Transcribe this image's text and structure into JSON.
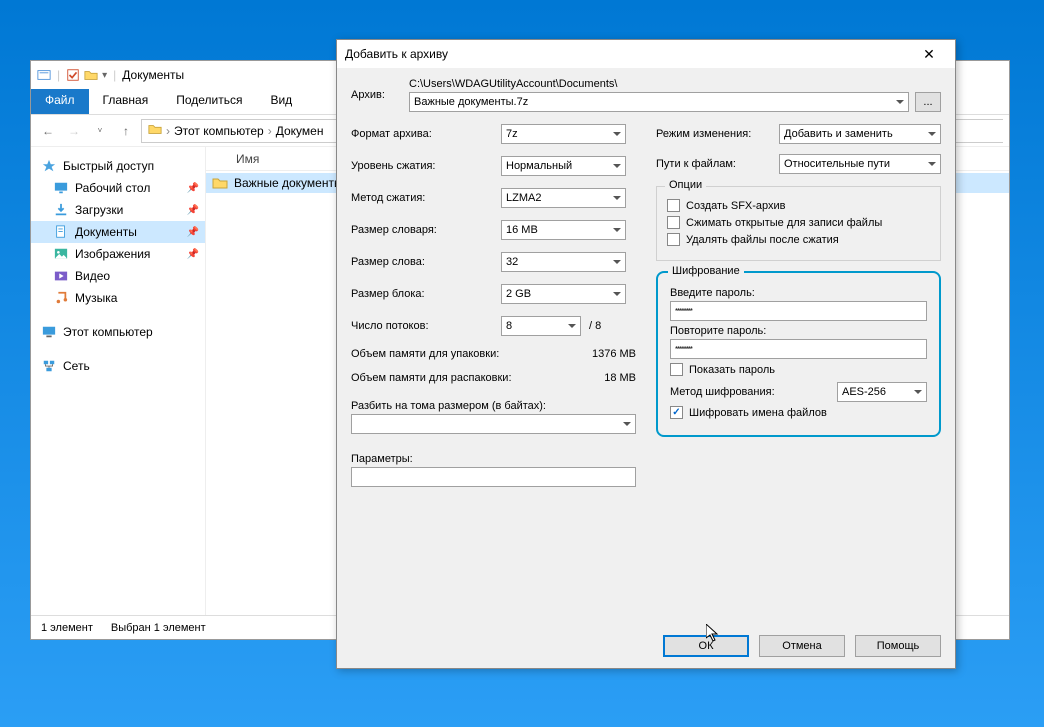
{
  "explorer": {
    "title": "Документы",
    "ribbon": {
      "tabs": [
        "Файл",
        "Главная",
        "Поделиться",
        "Вид"
      ]
    },
    "breadcrumb": {
      "root": "Этот компьютер",
      "current": "Докумен"
    },
    "sidebar": {
      "quick": "Быстрый доступ",
      "items": [
        {
          "label": "Рабочий стол",
          "pinned": true
        },
        {
          "label": "Загрузки",
          "pinned": true
        },
        {
          "label": "Документы",
          "pinned": true,
          "selected": true
        },
        {
          "label": "Изображения",
          "pinned": true
        },
        {
          "label": "Видео"
        },
        {
          "label": "Музыка"
        }
      ],
      "thispc": "Этот компьютер",
      "network": "Сеть"
    },
    "content": {
      "header_name": "Имя",
      "file": "Важные документы"
    },
    "status": {
      "count": "1 элемент",
      "selected": "Выбран 1 элемент"
    }
  },
  "dialog": {
    "title": "Добавить к архиву",
    "archive_label": "Архив:",
    "path": "C:\\Users\\WDAGUtilityAccount\\Documents\\",
    "name": "Важные документы.7z",
    "browse": "...",
    "left": {
      "format": {
        "label": "Формат архива:",
        "value": "7z"
      },
      "level": {
        "label": "Уровень сжатия:",
        "value": "Нормальный"
      },
      "method": {
        "label": "Метод сжатия:",
        "value": "LZMA2"
      },
      "dict": {
        "label": "Размер словаря:",
        "value": "16 MB"
      },
      "word": {
        "label": "Размер слова:",
        "value": "32"
      },
      "block": {
        "label": "Размер блока:",
        "value": "2 GB"
      },
      "threads": {
        "label": "Число потоков:",
        "value": "8",
        "suffix": "/ 8"
      },
      "mempack": {
        "label": "Объем памяти для упаковки:",
        "value": "1376 MB"
      },
      "memunpack": {
        "label": "Объем памяти для распаковки:",
        "value": "18 MB"
      },
      "split": "Разбить на тома размером (в байтах):",
      "params": "Параметры:"
    },
    "right": {
      "update": {
        "label": "Режим изменения:",
        "value": "Добавить и заменить"
      },
      "pathmode": {
        "label": "Пути к файлам:",
        "value": "Относительные пути"
      },
      "options": {
        "legend": "Опции",
        "sfx": "Создать SFX-архив",
        "shared": "Сжимать открытые для записи файлы",
        "delete": "Удалять файлы после сжатия"
      }
    },
    "encryption": {
      "legend": "Шифрование",
      "pass1_label": "Введите пароль:",
      "pass1": "********",
      "pass2_label": "Повторите пароль:",
      "pass2": "********",
      "show": "Показать пароль",
      "method_label": "Метод шифрования:",
      "method": "AES-256",
      "encnames": "Шифровать имена файлов",
      "encnames_checked": true
    },
    "buttons": {
      "ok": "ОК",
      "cancel": "Отмена",
      "help": "Помощь"
    }
  }
}
